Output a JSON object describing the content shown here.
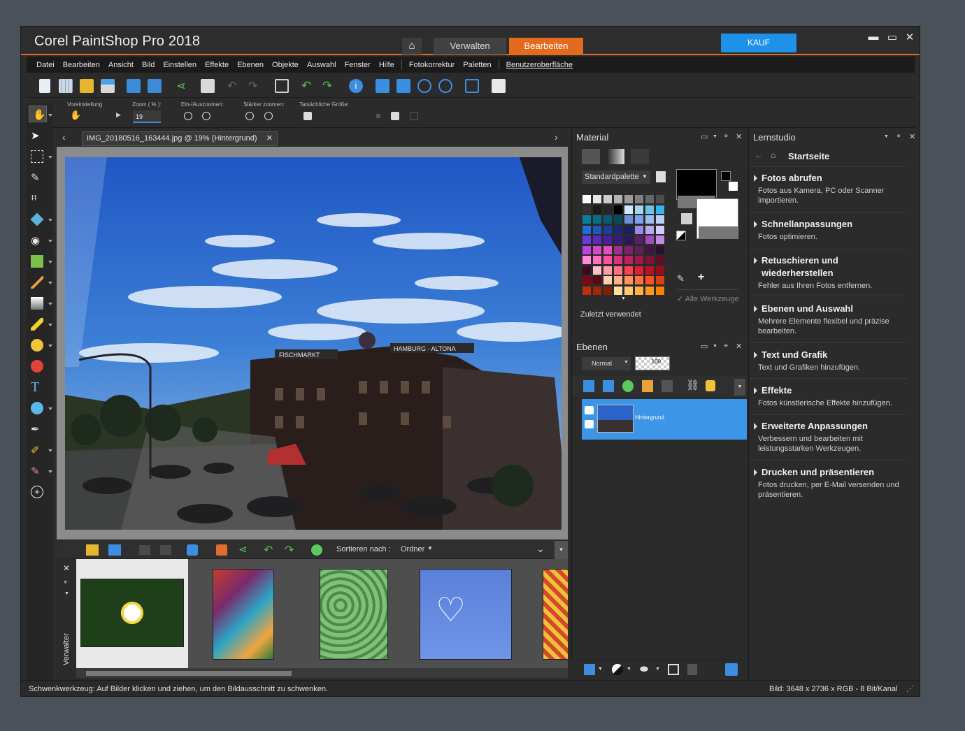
{
  "app": {
    "title": "Corel PaintShop Pro 2018"
  },
  "workspace_tabs": {
    "manage": "Verwalten",
    "edit": "Bearbeiten"
  },
  "buy_button": "KAUF",
  "menu": [
    "Datei",
    "Bearbeiten",
    "Ansicht",
    "Bild",
    "Einstellen",
    "Effekte",
    "Ebenen",
    "Objekte",
    "Auswahl",
    "Fenster",
    "Hilfe",
    "Fotokorrektur",
    "Paletten",
    "Benutzeroberfläche"
  ],
  "options": {
    "preset_label": "Voreinstellung",
    "zoom_label": "Zoom ( % ):",
    "zoom_value": "19",
    "zoom_inout_label": "Ein-/Auszoomen:",
    "zoom_more_label": "Stärker zoomen:",
    "actual_size_label": "Tatsächliche Größe:"
  },
  "document": {
    "tab_label": "IMG_20180516_163444.jpg @  19% (Hintergrund)"
  },
  "photo_signs": {
    "sign1": "FISCHMARKT",
    "sign2": "HAMBURG - ALTONA"
  },
  "organizer": {
    "sort_label": "Sortieren nach :",
    "sort_value": "Ordner",
    "side_label": "Verwalter"
  },
  "material": {
    "title": "Material",
    "palette_select": "Standardpalette",
    "recent_label": "Zuletzt verwendet",
    "all_tools": "Alle Werkzeuge"
  },
  "layers": {
    "title": "Ebenen",
    "blend_mode": "Normal",
    "opacity": "100",
    "layer_name": "Hintergrund"
  },
  "learn": {
    "title": "Lernstudio",
    "home": "Startseite",
    "sections": [
      {
        "title": "Fotos abrufen",
        "desc": "Fotos aus Kamera, PC oder Scanner importieren."
      },
      {
        "title": "Schnellanpassungen",
        "desc": "Fotos optimieren."
      },
      {
        "title": "Retuschieren und wiederherstellen",
        "desc": "Fehler aus Ihren Fotos entfernen."
      },
      {
        "title": "Ebenen und Auswahl",
        "desc": "Mehrere Elemente flexibel und präzise bearbeiten."
      },
      {
        "title": "Text und Grafik",
        "desc": "Text und Grafiken hinzufügen."
      },
      {
        "title": "Effekte",
        "desc": "Fotos künstlerische Effekte hinzufügen."
      },
      {
        "title": "Erweiterte Anpassungen",
        "desc": "Verbessern und bearbeiten mit leistungsstarken Werkzeugen."
      },
      {
        "title": "Drucken und präsentieren",
        "desc": "Fotos drucken, per E-Mail versenden und präsentieren."
      }
    ]
  },
  "status": {
    "left": "Schwenkwerkzeug: Auf Bilder klicken und ziehen, um den Bildausschnitt zu schwenken.",
    "right": "Bild:  3648 x 2736 x RGB - 8 Bit/Kanal"
  },
  "colors": {
    "accent": "#e46a1e",
    "buy": "#1e91e8",
    "selection": "#3d95e8"
  }
}
